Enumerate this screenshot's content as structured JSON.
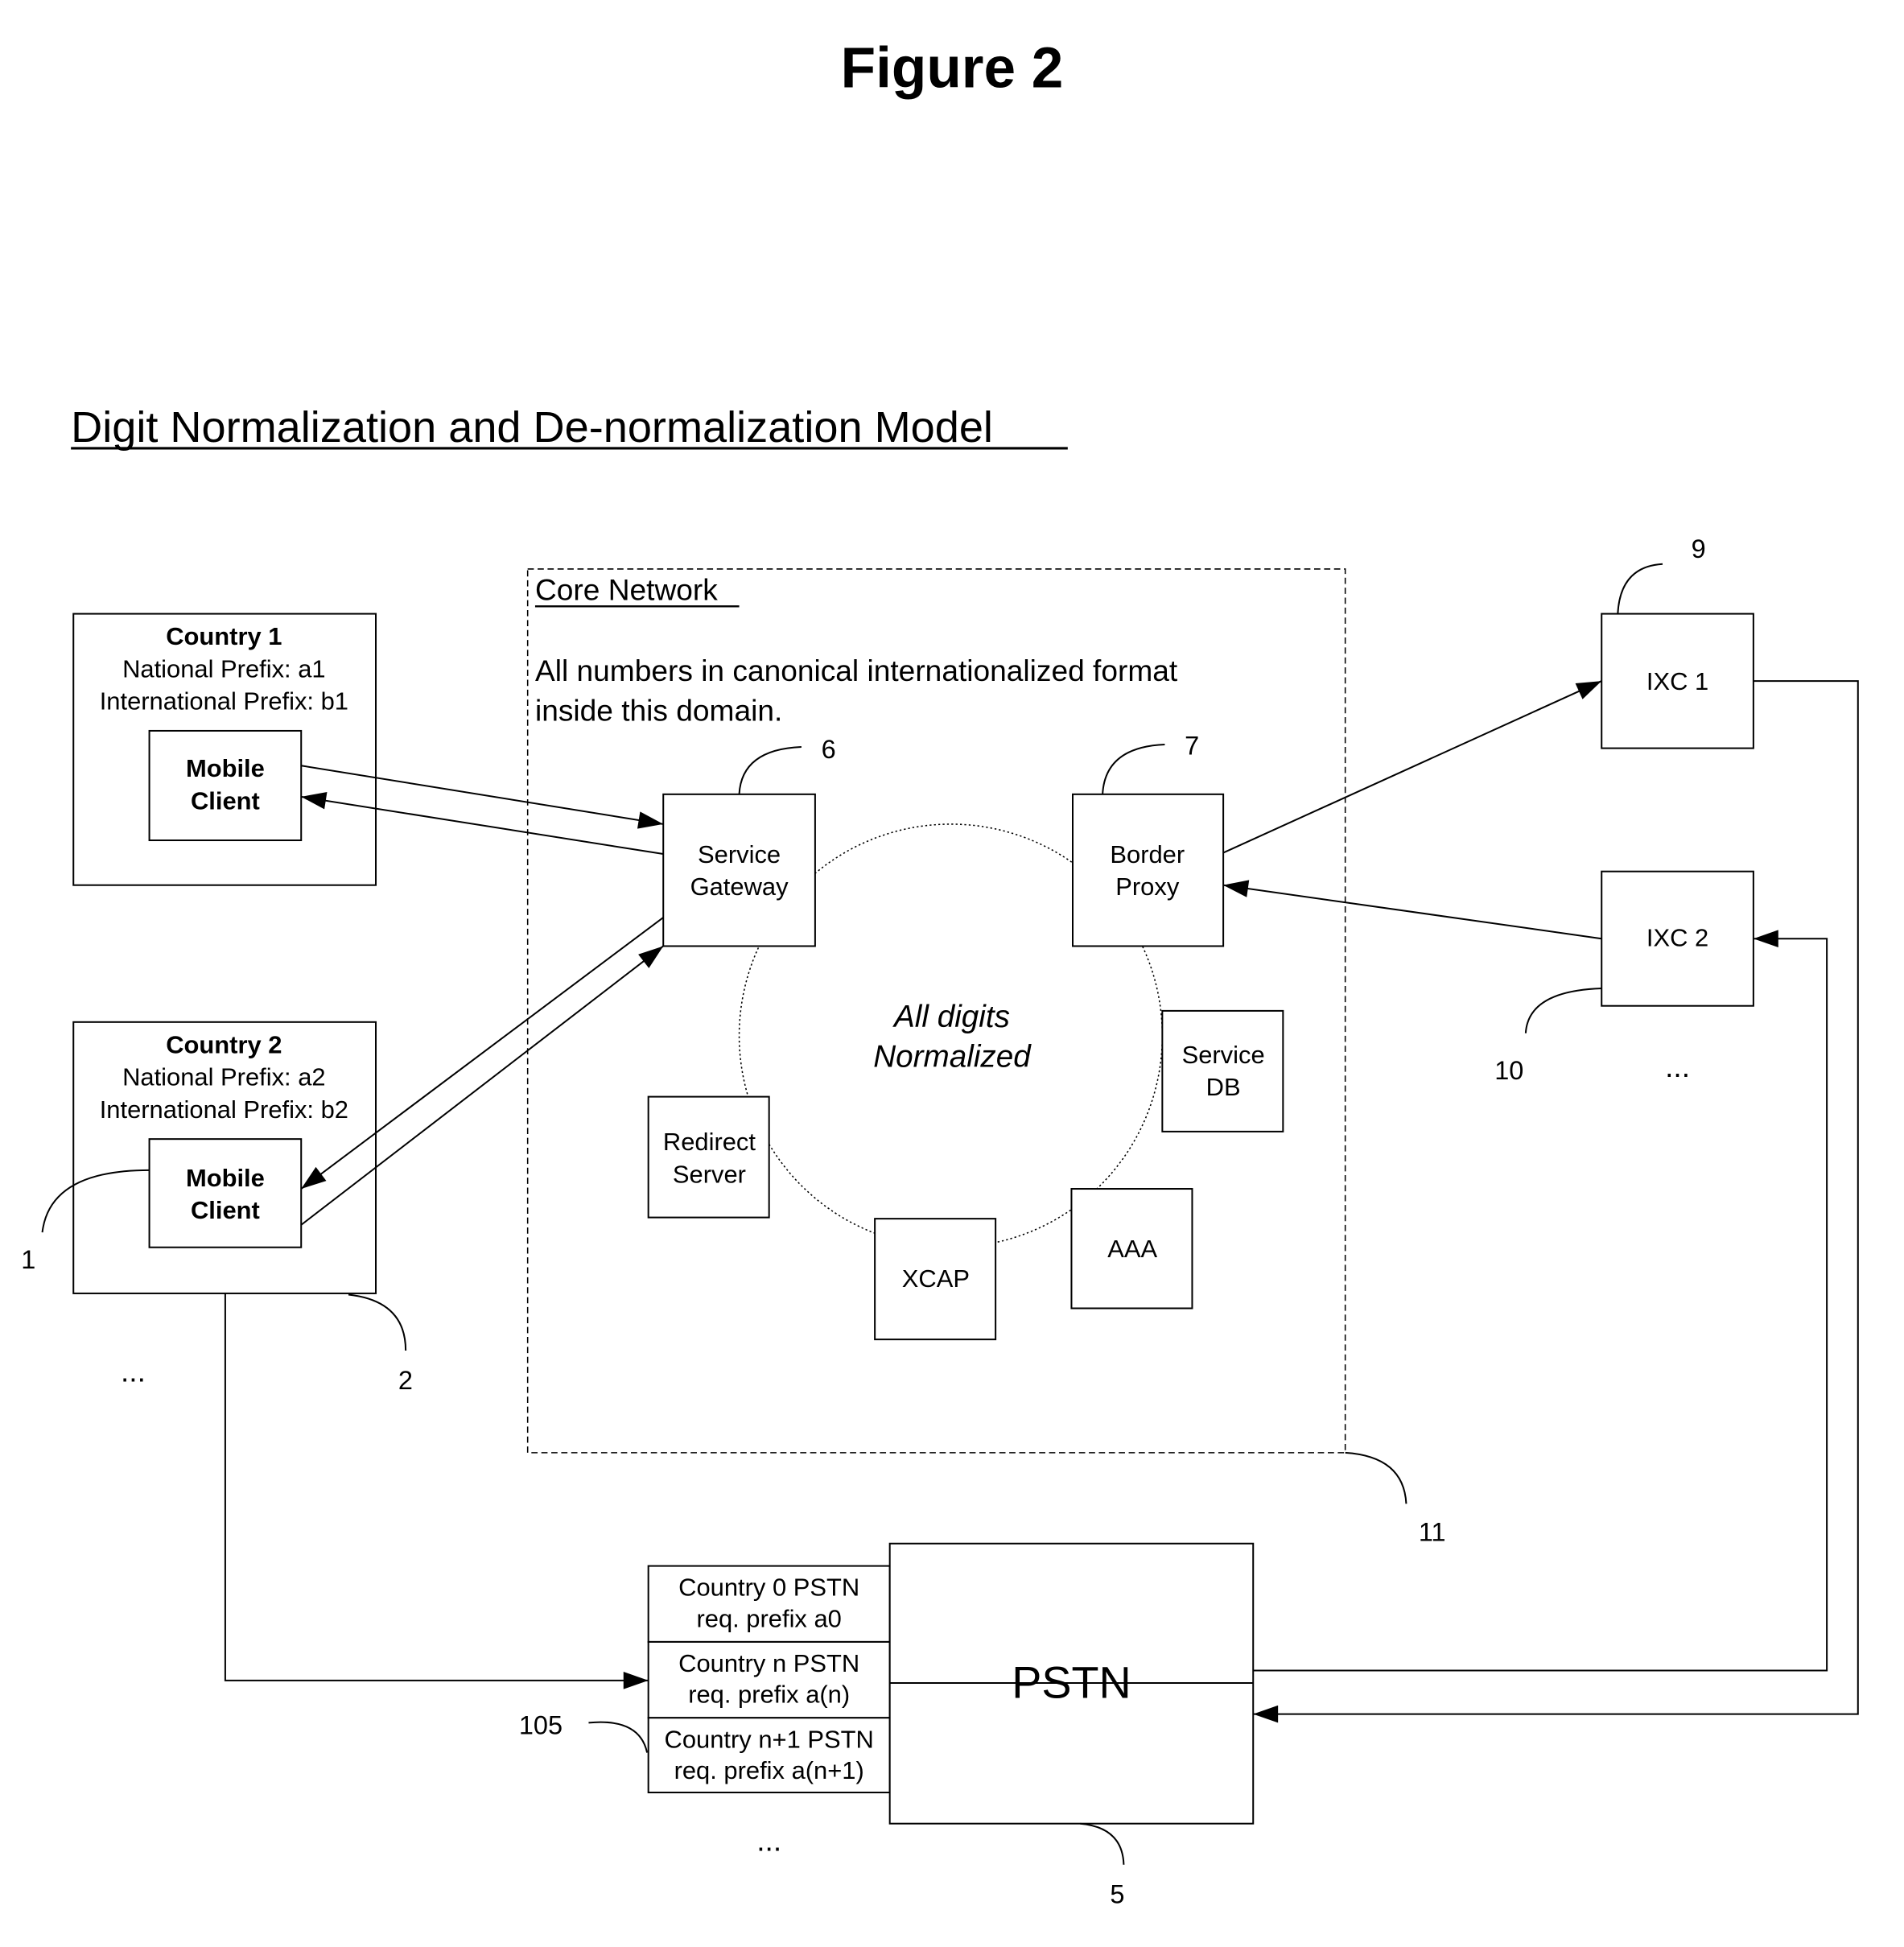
{
  "figure_title": "Figure 2",
  "subtitle": "Digit Normalization and De-normalization Model",
  "core_network": {
    "title": "Core Network",
    "description_line1": "All numbers in canonical internationalized format",
    "description_line2": "inside this domain.",
    "center_label_line1": "All digits",
    "center_label_line2": "Normalized",
    "ref": "11"
  },
  "countries": [
    {
      "name": "Country 1",
      "national_prefix": "National Prefix: a1",
      "international_prefix": "International Prefix: b1",
      "client_line1": "Mobile",
      "client_line2": "Client"
    },
    {
      "name": "Country 2",
      "national_prefix": "National Prefix: a2",
      "international_prefix": "International Prefix: b2",
      "client_line1": "Mobile",
      "client_line2": "Client",
      "ref_client": "1",
      "ref_country": "2"
    }
  ],
  "left_ellipsis": "...",
  "nodes": {
    "service_gateway": {
      "line1": "Service",
      "line2": "Gateway",
      "ref": "6"
    },
    "border_proxy": {
      "line1": "Border",
      "line2": "Proxy",
      "ref": "7"
    },
    "service_db": {
      "line1": "Service",
      "line2": "DB"
    },
    "redirect_server": {
      "line1": "Redirect",
      "line2": "Server"
    },
    "xcap": {
      "label": "XCAP"
    },
    "aaa": {
      "label": "AAA"
    }
  },
  "ixc": [
    {
      "label": "IXC 1",
      "ref": "9"
    },
    {
      "label": "IXC 2",
      "ref": "10"
    }
  ],
  "ixc_ellipsis": "...",
  "pstn": {
    "label": "PSTN",
    "ref": "5",
    "prefix_ref": "105",
    "rows": [
      {
        "line1": "Country 0 PSTN",
        "line2": "req. prefix a0"
      },
      {
        "line1": "Country n PSTN",
        "line2": "req. prefix a(n)"
      },
      {
        "line1": "Country n+1 PSTN",
        "line2": "req. prefix a(n+1)"
      }
    ],
    "ellipsis": "..."
  }
}
